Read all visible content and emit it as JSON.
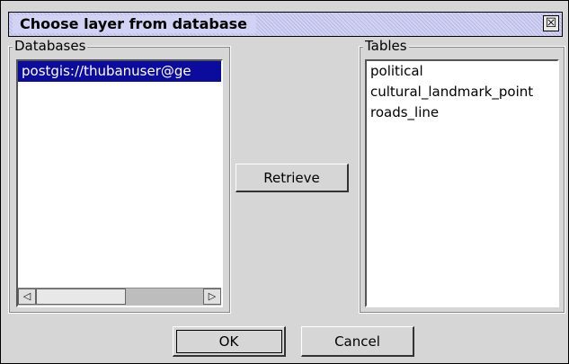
{
  "window": {
    "title": "Choose layer from database",
    "close_glyph": "☒"
  },
  "databases": {
    "label": "Databases",
    "items": [
      "postgis://thubanuser@ge"
    ],
    "scroll_left": "◁",
    "scroll_right": "▷"
  },
  "tables": {
    "label": "Tables",
    "items": [
      "political",
      "cultural_landmark_point",
      "roads_line"
    ]
  },
  "buttons": {
    "retrieve": "Retrieve",
    "ok": "OK",
    "cancel": "Cancel"
  }
}
